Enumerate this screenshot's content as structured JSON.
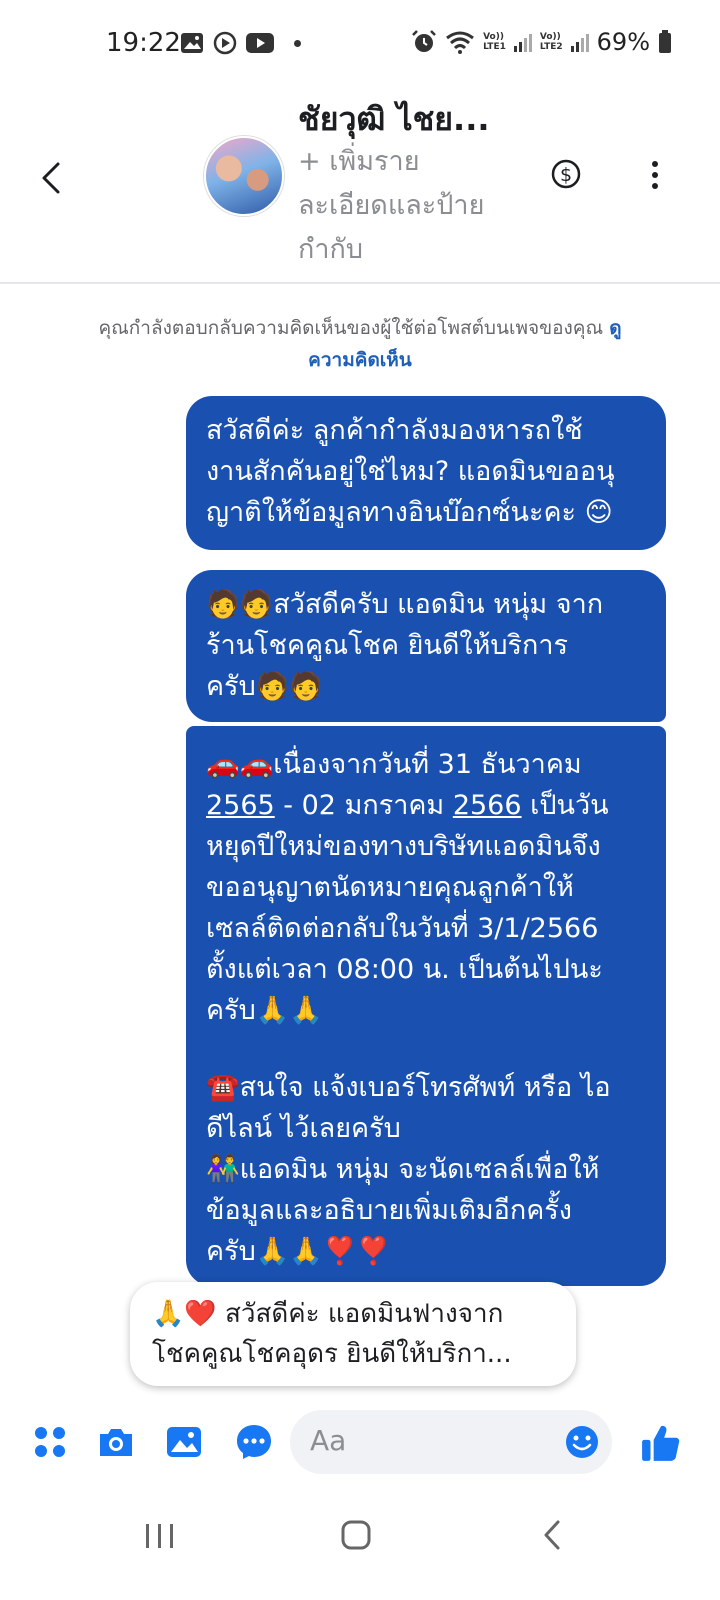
{
  "status_bar": {
    "time": "19:22",
    "battery": "69%",
    "sim1": [
      "Vo))",
      "LTE1"
    ],
    "sim2": [
      "Vo))",
      "LTE2"
    ],
    "left_icons": [
      "gallery-icon",
      "screen-record-icon",
      "youtube-icon"
    ],
    "right_icons": [
      "alarm-icon",
      "wifi-icon",
      "signal-icon",
      "battery-icon"
    ]
  },
  "header": {
    "contact_name": "ชัยวุฒิ ไชย...",
    "subtitle_lines": [
      "+ เพิ่มราย",
      "ละเอียดและป้าย",
      "กำกับ"
    ]
  },
  "notice": {
    "text": "คุณกำลังตอบกลับความคิดเห็นของผู้ใช้ต่อโพสต์บนเพจของคุณ",
    "link": "ดูความคิดเห็น"
  },
  "messages": {
    "m1": [
      "สวัสดีค่ะ ลูกค้ากำลังมองหารถใช้",
      "งานสักคันอยู่ใช่ไหม? แอดมินขออนุ",
      "ญาติให้ข้อมูลทางอินบ๊อกซ์นะคะ 😊"
    ],
    "m2": [
      "🧑🧑สวัสดีครับ แอดมิน หนุ่ม จาก",
      "ร้านโชคคูณโชค ยินดีให้บริการ",
      "ครับ🧑🧑"
    ],
    "m3": {
      "l1": "🚗🚗เนื่องจากวันที่ 31 ธันวาคม",
      "l2a": "2565",
      "l2b": " - 02 มกราคม ",
      "l2c": "2566",
      "l2d": " เป็นวัน",
      "l3": "หยุดปีใหม่ของทางบริษัทแอดมินจึง",
      "l4": "ขออนุญาตนัดหมายคุณลูกค้าให้",
      "l5": "เซลล์ติดต่อกลับในวันที่  3/1/2566",
      "l6": "ตั้งแต่เวลา 08:00 น. เป็นต้นไปนะ",
      "l7": "ครับ🙏🙏",
      "l8": "☎️สนใจ แจ้งเบอร์โทรศัพท์ หรือ ไอ",
      "l9": "ดีไลน์  ไว้เลยครับ",
      "l10": " 👫แอดมิน หนุ่ม จะนัดเซลล์เพื่อให้",
      "l11": "ข้อมูลและอธิบายเพิ่มเติมอีกครั้ง",
      "l12": "ครับ🙏🙏❣️❣️"
    }
  },
  "suggestion": {
    "lines": [
      "🙏❤️ สวัสดีค่ะ แอดมินฟางจาก",
      "โชคคูณโชคอุดร ยินดีให้บริกา..."
    ]
  },
  "composer": {
    "placeholder": "Aa"
  },
  "colors": {
    "bubble": "#1a51b0",
    "accent": "#1877f2",
    "link": "#1e5fb8"
  }
}
